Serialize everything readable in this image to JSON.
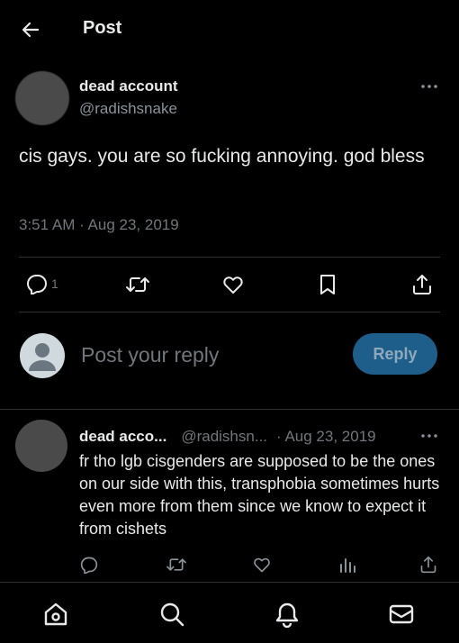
{
  "header": {
    "title": "Post",
    "back_icon": "arrow-left-icon"
  },
  "tweet": {
    "author_name": "dead account",
    "author_handle": "@radishsnake",
    "text": "cis gays. you are so fucking annoying. god bless",
    "time": "3:51 AM · Aug 23, 2019",
    "actions": {
      "reply_count": "1",
      "icons": [
        "reply-icon",
        "retweet-icon",
        "like-icon",
        "bookmark-icon",
        "share-icon"
      ]
    }
  },
  "compose": {
    "placeholder": "Post your reply",
    "button_label": "Reply"
  },
  "comment": {
    "author_name": "dead acco...",
    "author_handle": "@radishsn...",
    "date": "· Aug 23, 2019",
    "text": "fr tho lgb cisgenders are supposed to be the ones on our side with this, transphobia sometimes hurts even more from them since we know to expect it from cishets",
    "icons": [
      "reply-icon",
      "retweet-icon",
      "like-icon",
      "views-icon",
      "share-icon"
    ]
  },
  "bottom_nav": {
    "icons": [
      "home-icon",
      "search-icon",
      "notifications-icon",
      "messages-icon"
    ]
  },
  "colors": {
    "background": "#000000",
    "text": "#e7e9ea",
    "muted": "#71767b",
    "divider": "#2f3336",
    "reply_button": "#1d5f8a"
  }
}
